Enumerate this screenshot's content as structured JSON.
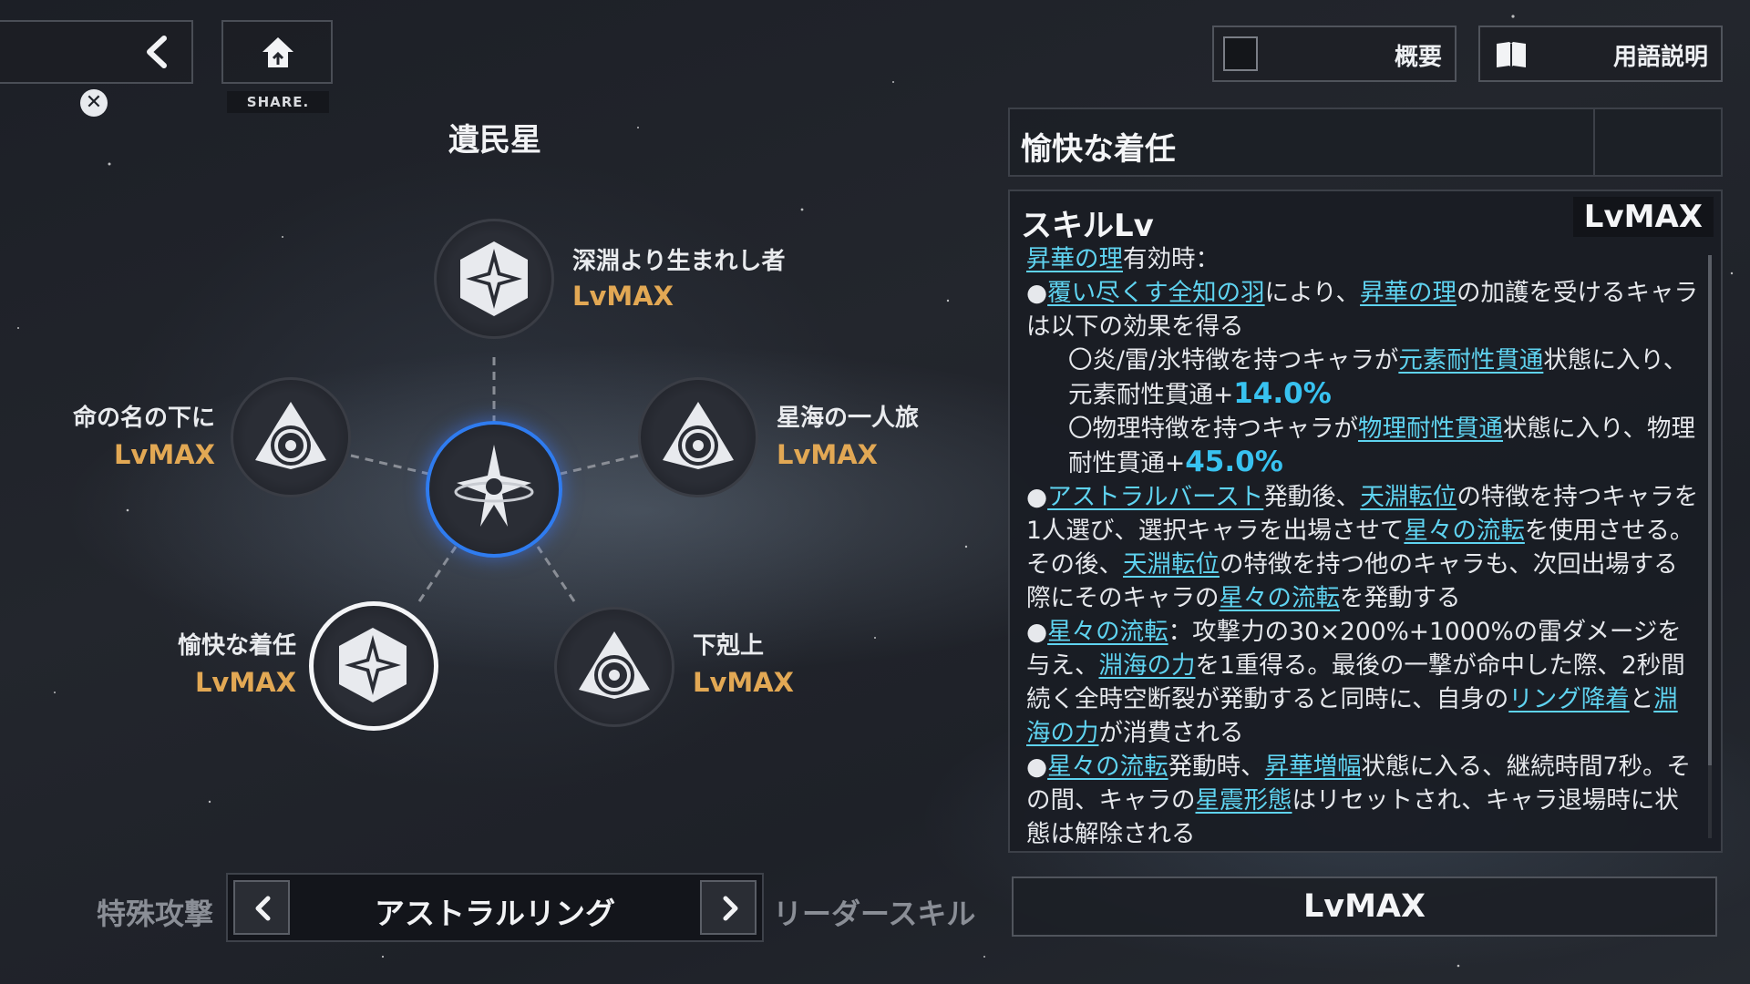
{
  "header": {
    "share_label": "SHARE.",
    "overview_label": "概要",
    "glossary_label": "用語説明"
  },
  "constellation": {
    "title": "遺民星",
    "nodes": [
      {
        "name": "深淵より生まれし者",
        "level": "LvMAX"
      },
      {
        "name": "命の名の下に",
        "level": "LvMAX"
      },
      {
        "name": "星海の一人旅",
        "level": "LvMAX"
      },
      {
        "name": "愉快な着任",
        "level": "LvMAX"
      },
      {
        "name": "下剋上",
        "level": "LvMAX"
      }
    ]
  },
  "selector": {
    "left_label": "特殊攻撃",
    "current": "アストラルリング",
    "right_label": "リーダースキル"
  },
  "skill": {
    "title": "愉快な着任",
    "lv_label": "スキルLv",
    "lv_value": "LvMAX",
    "bottom_level": "LvMAX",
    "desc": {
      "l1_kw": "昇華の理",
      "l1_t": "有効時：",
      "l2_b": "●",
      "l2_kw1": "覆い尽くす全知の羽",
      "l2_t1": "により、",
      "l2_kw2": "昇華の理",
      "l2_t2": "の加護を受けるキャラは以下の効果を得る",
      "l3_t1": "〇炎/雷/氷特徴を持つキャラが",
      "l3_kw": "元素耐性貫通",
      "l3_t2": "状態に入り、元素耐性貫通+",
      "l3_num": "14.0%",
      "l4_t1": "〇物理特徴を持つキャラが",
      "l4_kw": "物理耐性貫通",
      "l4_t2": "状態に入り、物理耐性貫通+",
      "l4_num": "45.0%",
      "l5_b": "●",
      "l5_kw1": "アストラルバースト",
      "l5_t1": "発動後、",
      "l5_kw2": "天淵転位",
      "l5_t2": "の特徴を持つキャラを1人選び、選択キャラを出場させて",
      "l5_kw3": "星々の流転",
      "l5_t3": "を使用させる。その後、",
      "l5_kw4": "天淵転位",
      "l5_t4": "の特徴を持つ他のキャラも、次回出場する際にそのキャラの",
      "l5_kw5": "星々の流転",
      "l5_t5": "を発動する",
      "l6_b": "●",
      "l6_kw1": "星々の流転",
      "l6_t1": "：攻撃力の30×200%+1000%の雷ダメージを与え、",
      "l6_kw2": "淵海の力",
      "l6_t2": "を1重得る。最後の一撃が命中した際、2秒間続く全時空断裂が発動すると同時に、自身の",
      "l6_kw3": "リング降着",
      "l6_t3": "と",
      "l6_kw4": "淵海の力",
      "l6_t4": "が消費される",
      "l7_b": "●",
      "l7_kw1": "星々の流転",
      "l7_t1": "発動時、",
      "l7_kw2": "昇華増幅",
      "l7_t2": "状態に入る、継続時間7秒。その間、キャラの",
      "l7_kw3": "星震形態",
      "l7_t3": "はリセットされ、キャラ退場時に状態は解除される"
    }
  },
  "colors": {
    "level_gold": "#e2a854",
    "keyword_cyan": "#5fd3f0",
    "selected_ring_blue": "#2f7cf0"
  },
  "icons": [
    "chevron-left-icon",
    "close-icon",
    "home-icon",
    "book-icon",
    "chevron-right-icon"
  ]
}
